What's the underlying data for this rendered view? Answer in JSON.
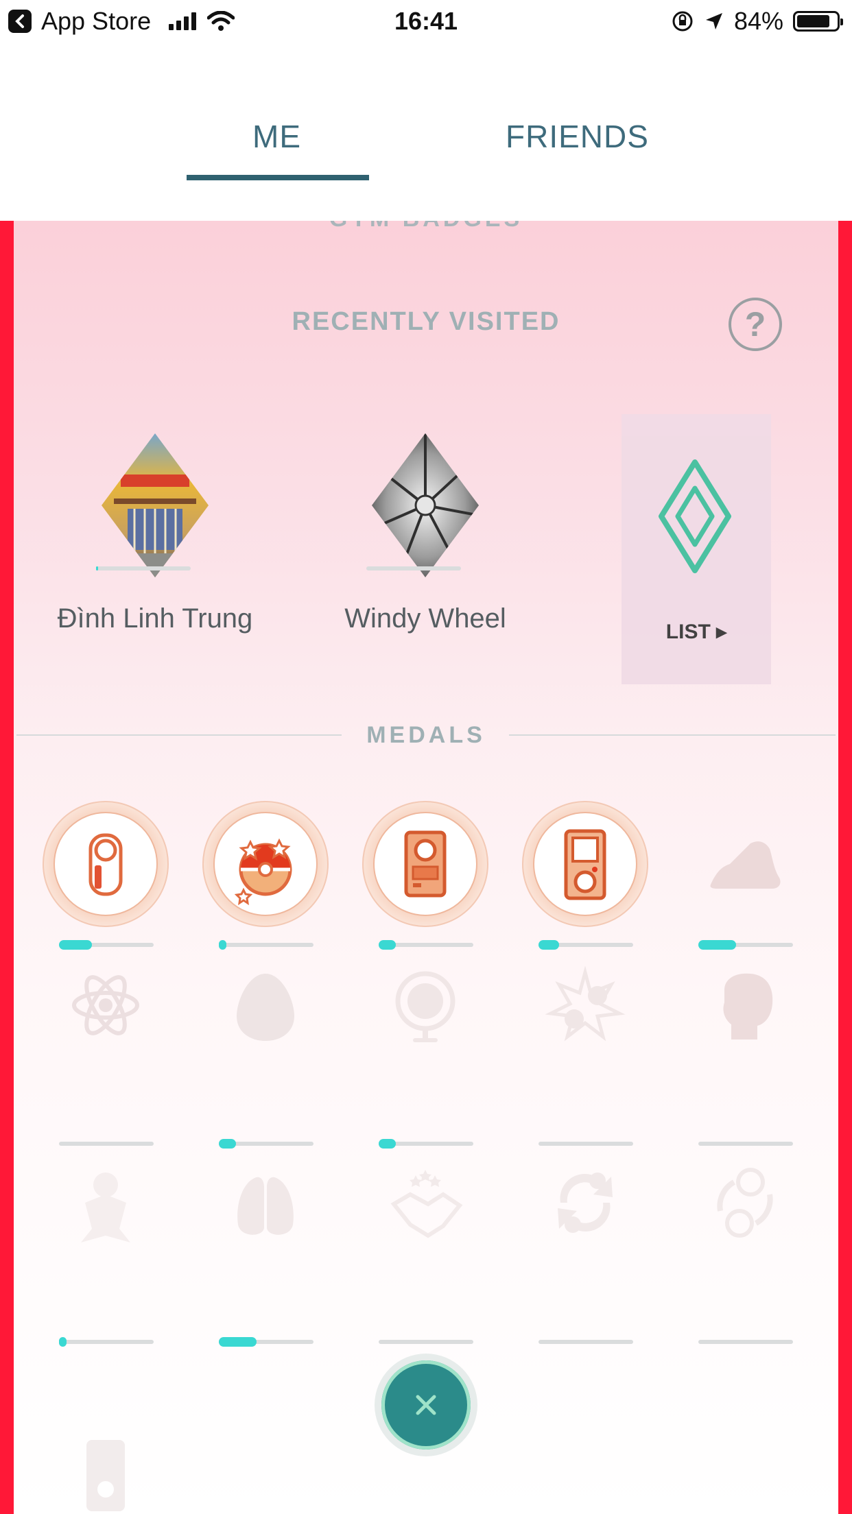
{
  "status_bar": {
    "back_app": "App Store",
    "time": "16:41",
    "battery": "84%",
    "battery_level": 0.84
  },
  "tabs": [
    {
      "label": "ME",
      "active": true
    },
    {
      "label": "FRIENDS",
      "active": false
    }
  ],
  "gym_section": {
    "cut_heading": "GYM BADGES",
    "title": "RECENTLY VISITED",
    "help_label": "?",
    "gyms": [
      {
        "name": "Đình Linh Trung",
        "progress": 0.02
      },
      {
        "name": "Windy Wheel",
        "progress": 0.0
      }
    ],
    "list_label": "LIST ▸"
  },
  "medals": {
    "title": "MEDALS",
    "items": [
      {
        "icon": "device-icon",
        "unlocked": true,
        "progress": 0.35
      },
      {
        "icon": "pokeball-stars-icon",
        "unlocked": true,
        "progress": 0.02
      },
      {
        "icon": "pokedex-icon",
        "unlocked": true,
        "progress": 0.18
      },
      {
        "icon": "pokedex-flip-icon",
        "unlocked": true,
        "progress": 0.22
      },
      {
        "icon": "running-shoe-icon",
        "unlocked": false,
        "progress": 0.4
      },
      {
        "icon": "atom-icon",
        "unlocked": false,
        "progress": 0.0
      },
      {
        "icon": "egg-icon",
        "unlocked": false,
        "progress": 0.18
      },
      {
        "icon": "pokestop-icon",
        "unlocked": false,
        "progress": 0.18
      },
      {
        "icon": "pokeball-burst-icon",
        "unlocked": false,
        "progress": 0.0
      },
      {
        "icon": "boxing-glove-icon",
        "unlocked": false,
        "progress": 0.0
      },
      {
        "icon": "flower-pokemon-icon",
        "unlocked": false,
        "progress": 0.02
      },
      {
        "icon": "binoculars-icon",
        "unlocked": false,
        "progress": 0.4
      },
      {
        "icon": "handshake-stars-icon",
        "unlocked": false,
        "progress": 0.0
      },
      {
        "icon": "trade-arrows-icon",
        "unlocked": false,
        "progress": 0.0
      },
      {
        "icon": "pokeball-swap-icon",
        "unlocked": false,
        "progress": 0.0
      },
      {
        "icon": "device-small-icon",
        "unlocked": false,
        "progress": null
      }
    ]
  },
  "colors": {
    "tab_text": "#3e6b7c",
    "tab_underline": "#2f6170",
    "progress_fill": "#3ad8d2",
    "edge_red": "#ff1837",
    "list_icon": "#3dbf9c",
    "fab": "#2b8b8a"
  },
  "close_button": {
    "icon": "close-icon"
  }
}
